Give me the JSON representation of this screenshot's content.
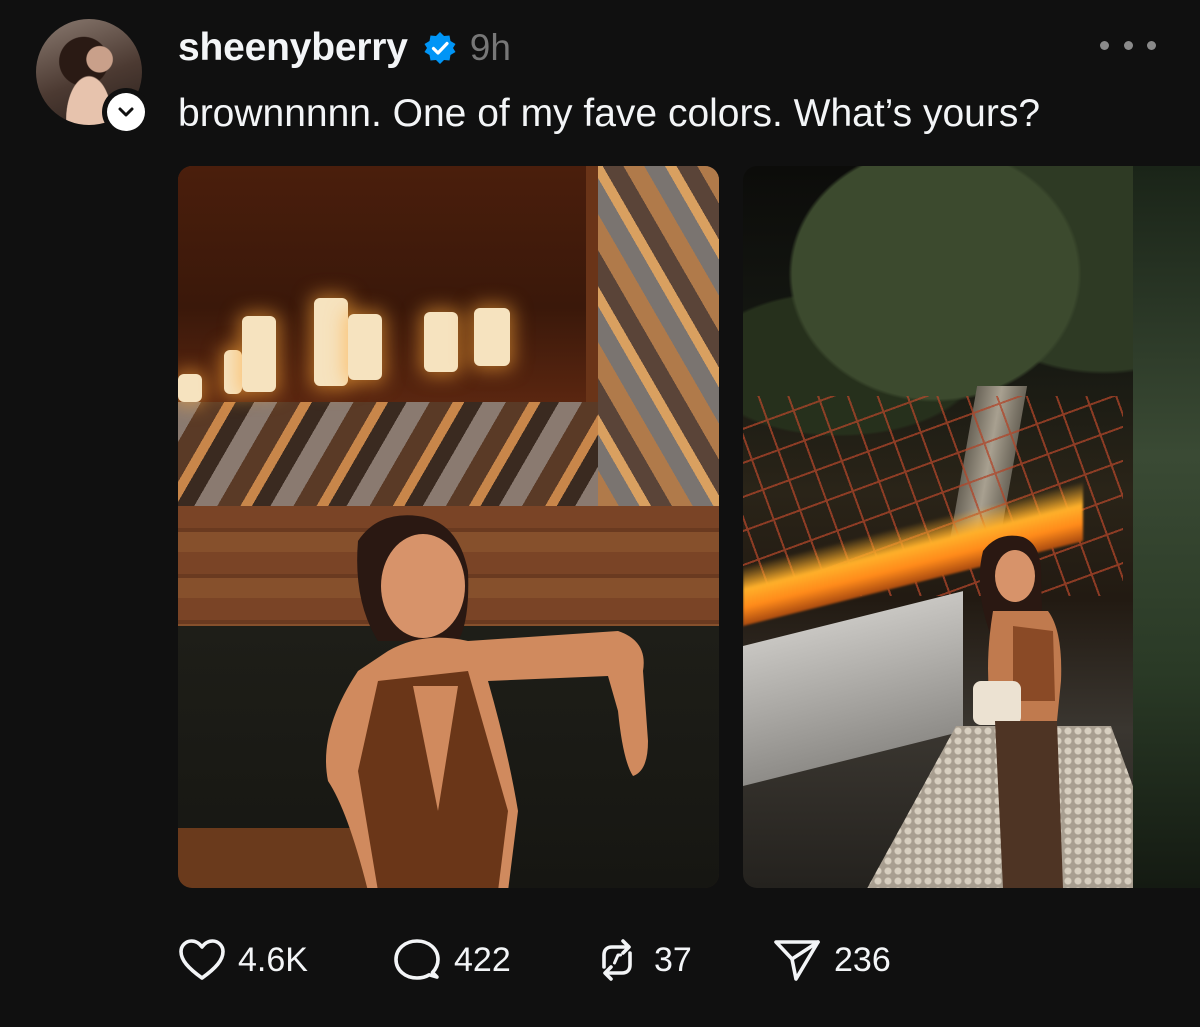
{
  "post": {
    "username": "sheenyberry",
    "verified": true,
    "time": "9h",
    "caption": "brownnnnn. One of my fave colors. What’s yours?",
    "media_count": 2
  },
  "actions": {
    "likes": "4.6K",
    "replies": "422",
    "reposts": "37",
    "shares": "236"
  },
  "icons": {
    "verified": "verified-badge-icon",
    "follow": "chevron-down-icon",
    "more": "more-options-icon",
    "like": "heart-icon",
    "reply": "comment-bubble-icon",
    "repost": "repost-icon",
    "share": "send-icon"
  },
  "colors": {
    "background": "#101010",
    "text": "#f3f5f7",
    "muted": "#777777",
    "verified": "#0095f6"
  }
}
